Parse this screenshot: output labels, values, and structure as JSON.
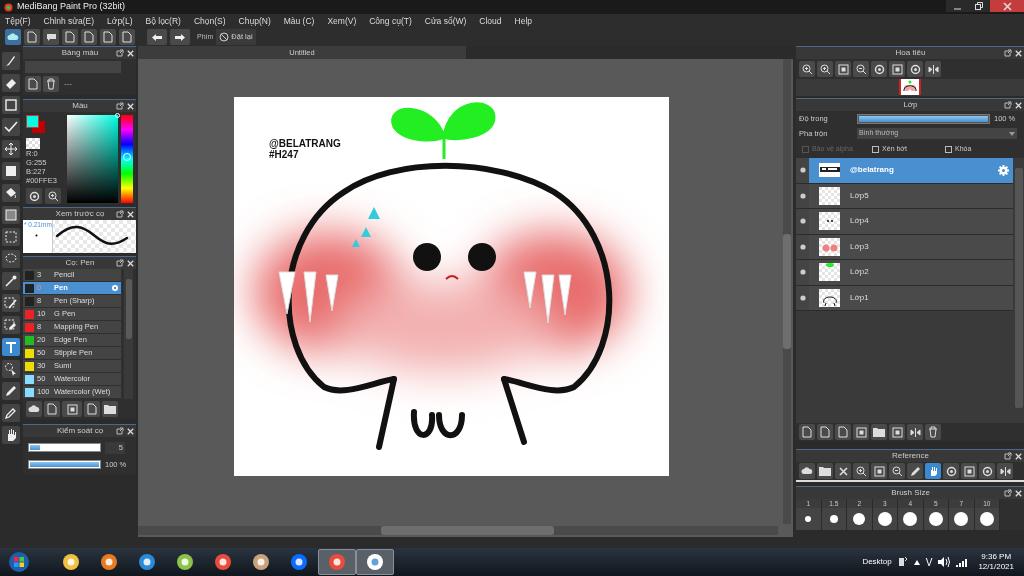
{
  "window": {
    "title": "MediBang Paint Pro (32bit)"
  },
  "menu": [
    "Tệp(F)",
    "Chỉnh sửa(E)",
    "Lớp(L)",
    "Bộ lọc(R)",
    "Chọn(S)",
    "Chụp(N)",
    "Màu (C)",
    "Xem(V)",
    "Công cụ(T)",
    "Cửa sổ(W)",
    "Cloud",
    "Help"
  ],
  "toolbar": {
    "shortcut_label": "Phím",
    "reset_button": "Đặt lại"
  },
  "tools": [
    {
      "kind": "brush",
      "selected": false
    },
    {
      "kind": "eraser",
      "selected": false
    },
    {
      "kind": "rect",
      "selected": false
    },
    {
      "kind": "check",
      "selected": false
    },
    {
      "kind": "move",
      "selected": false
    },
    {
      "kind": "fill",
      "selected": false
    },
    {
      "kind": "bucket",
      "selected": false
    },
    {
      "kind": "gradient",
      "selected": false
    },
    {
      "kind": "select",
      "selected": false
    },
    {
      "kind": "lasso",
      "selected": false
    },
    {
      "kind": "wand",
      "selected": false
    },
    {
      "kind": "selpen",
      "selected": false
    },
    {
      "kind": "seleraser",
      "selected": false
    },
    {
      "kind": "text",
      "selected": true
    },
    {
      "kind": "operation",
      "selected": false
    },
    {
      "kind": "pen",
      "selected": false
    },
    {
      "kind": "dropper",
      "selected": false
    },
    {
      "kind": "hand",
      "selected": false
    }
  ],
  "palette_panel": {
    "title": "Bảng màu",
    "separator": "---"
  },
  "color_panel": {
    "title": "Màu",
    "readout": [
      "R:0",
      "G:255",
      "B:227",
      "#00FFE3"
    ]
  },
  "brush_preview": {
    "title": "Xem trước cọ",
    "size": "* 0.21mm"
  },
  "brushes": {
    "title": "Cọ: Pen",
    "items": [
      {
        "size": "3",
        "name": "Pencil",
        "color": "#222222",
        "selected": false
      },
      {
        "size": "0",
        "name": "Pen",
        "color": "#222222",
        "selected": true
      },
      {
        "size": "8",
        "name": "Pen (Sharp)",
        "color": "#222222",
        "selected": false
      },
      {
        "size": "10",
        "name": "G Pen",
        "color": "#ee2222",
        "selected": false
      },
      {
        "size": "8",
        "name": "Mapping Pen",
        "color": "#ee2222",
        "selected": false
      },
      {
        "size": "20",
        "name": "Edge Pen",
        "color": "#22bb22",
        "selected": false
      },
      {
        "size": "50",
        "name": "Stipple Pen",
        "color": "#eedd00",
        "selected": false
      },
      {
        "size": "30",
        "name": "Sumi",
        "color": "#eedd00",
        "selected": false
      },
      {
        "size": "50",
        "name": "Watercolor",
        "color": "#88ddff",
        "selected": false
      },
      {
        "size": "100",
        "name": "Watercolor (Wet)",
        "color": "#88ddff",
        "selected": false
      }
    ]
  },
  "brush_control": {
    "title": "Kiểm soát cọ",
    "size": {
      "level": 0.15,
      "reading": "5"
    },
    "opacity": {
      "level": 1,
      "reading": "100 %"
    }
  },
  "document": {
    "tab": "Untitled",
    "canvas_text": [
      "@BELATRANG",
      "#H247"
    ]
  },
  "navigator": {
    "title": "Hoa tiêu"
  },
  "layers_panel": {
    "title": "Lớp",
    "opacity_label": "Độ trong",
    "opacity": {
      "level": 1,
      "reading": "100 %"
    },
    "blend_label": "Pha trộn",
    "blend": "Bình thường",
    "options": [
      {
        "label": "Bảo vệ alpha",
        "checked": false,
        "disabled": true
      },
      {
        "label": "Xén bớt",
        "checked": false,
        "disabled": false
      },
      {
        "label": "Khóa",
        "checked": false,
        "disabled": false
      }
    ],
    "layers": [
      {
        "name": "@belatrang",
        "kind": "text",
        "selected": true
      },
      {
        "name": "Lớp5",
        "kind": "empty",
        "selected": false
      },
      {
        "name": "Lớp4",
        "kind": "eyes",
        "selected": false
      },
      {
        "name": "Lớp3",
        "kind": "blush",
        "selected": false
      },
      {
        "name": "Lớp2",
        "kind": "sprout",
        "selected": false
      },
      {
        "name": "Lớp1",
        "kind": "outline",
        "selected": false
      }
    ]
  },
  "reference": {
    "title": "Reference"
  },
  "brush_size": {
    "title": "Brush Size",
    "sizes": [
      "1",
      "1.5",
      "2",
      "3",
      "4",
      "5",
      "7",
      "10"
    ]
  },
  "taskbar": {
    "desktop": "Desktop",
    "ime": "V",
    "time": "9:36 PM",
    "date": "12/1/2021"
  }
}
